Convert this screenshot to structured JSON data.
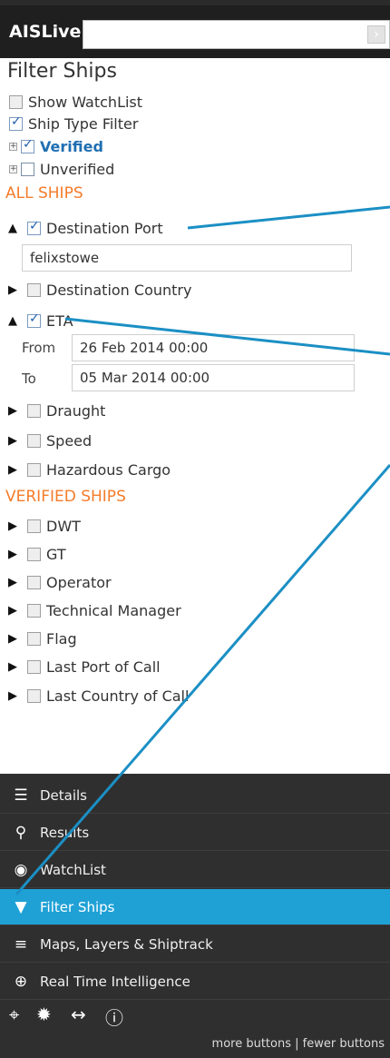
{
  "app": {
    "brand": "AISLive",
    "search_placeholder": "",
    "search_go": "›"
  },
  "panel": {
    "title": "Filter Ships",
    "top_options": [
      {
        "label": "Show WatchList",
        "checked": false
      },
      {
        "label": "Ship Type Filter",
        "checked": true
      }
    ],
    "type_options": [
      {
        "label": "Verified",
        "checked": true
      },
      {
        "label": "Unverified",
        "checked": false
      }
    ],
    "all_ships_title": "ALL SHIPS",
    "destination_port": {
      "label": "Destination Port",
      "checked": true,
      "value": "felixstowe"
    },
    "destination_country": {
      "label": "Destination Country",
      "checked": false
    },
    "eta": {
      "label": "ETA",
      "checked": true,
      "from_label": "From",
      "from_value": "26 Feb 2014 00:00",
      "to_label": "To",
      "to_value": "05 Mar 2014 00:00"
    },
    "other_all": [
      {
        "label": "Draught",
        "checked": false
      },
      {
        "label": "Speed",
        "checked": false
      },
      {
        "label": "Hazardous Cargo",
        "checked": false
      }
    ],
    "verified_title": "VERIFIED SHIPS",
    "verified": [
      {
        "label": "DWT",
        "checked": false
      },
      {
        "label": "GT",
        "checked": false
      },
      {
        "label": "Operator",
        "checked": false
      },
      {
        "label": "Technical Manager",
        "checked": false
      },
      {
        "label": "Flag",
        "checked": false
      },
      {
        "label": "Last Port of Call",
        "checked": false
      },
      {
        "label": "Last Country of Call",
        "checked": false
      }
    ]
  },
  "nav": [
    {
      "label": "Details",
      "icon": "details-icon",
      "active": false
    },
    {
      "label": "Results",
      "icon": "search-icon",
      "active": false
    },
    {
      "label": "WatchList",
      "icon": "binoculars-icon",
      "active": false
    },
    {
      "label": "Filter Ships",
      "icon": "filter-icon",
      "active": true
    },
    {
      "label": "Maps, Layers & Shiptrack",
      "icon": "layers-icon",
      "active": false
    },
    {
      "label": "Real Time Intelligence",
      "icon": "globe-icon",
      "active": false
    }
  ],
  "tools": [
    "crosshair-icon",
    "sun-icon",
    "measure-icon",
    "info-icon"
  ],
  "footer": {
    "more": "more buttons",
    "sep": " | ",
    "fewer": "fewer buttons"
  },
  "colors": {
    "accent": "#1fa1d6",
    "section": "#f47c2a",
    "nav_bg": "#2f2f2f"
  }
}
